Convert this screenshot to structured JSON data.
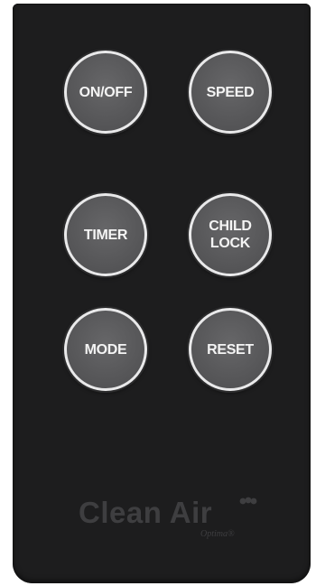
{
  "buttons": {
    "on_off": "ON/OFF",
    "speed": "SPEED",
    "timer": "TIMER",
    "child_lock": "CHILD\nLOCK",
    "mode": "MODE",
    "reset": "RESET"
  },
  "brand": {
    "name": "Clean Air",
    "sub": "Optima®"
  },
  "colors": {
    "body": "#1d1d1e",
    "button_fill": "#58585a",
    "button_ring": "#e9e9ea",
    "logo": "#3e3e40"
  }
}
